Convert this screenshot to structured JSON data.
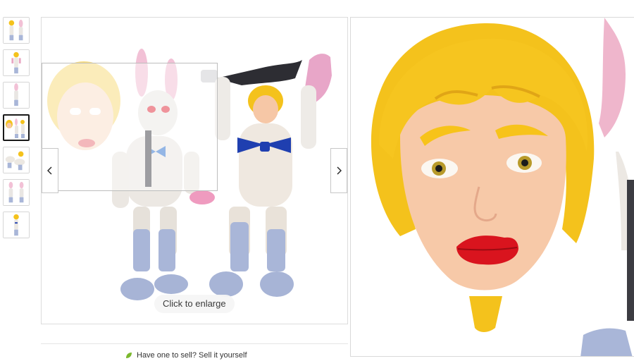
{
  "gallery": {
    "enlarge_label": "Click to enlarge",
    "thumbnail_count": 7,
    "selected_thumbnail": 4
  },
  "below_gallery": {
    "text": "Have one to sell? Sell it yourself"
  },
  "icons": {
    "prev": "chevron-left-icon",
    "next": "chevron-right-icon",
    "leaf": "leaf-icon"
  },
  "colors": {
    "hair": "#f4c21c",
    "skin": "#f6c7a6",
    "lips": "#d9141e",
    "bow": "#1f3fb0",
    "boots": "#a9b6d8",
    "selected_border": "#191919"
  }
}
